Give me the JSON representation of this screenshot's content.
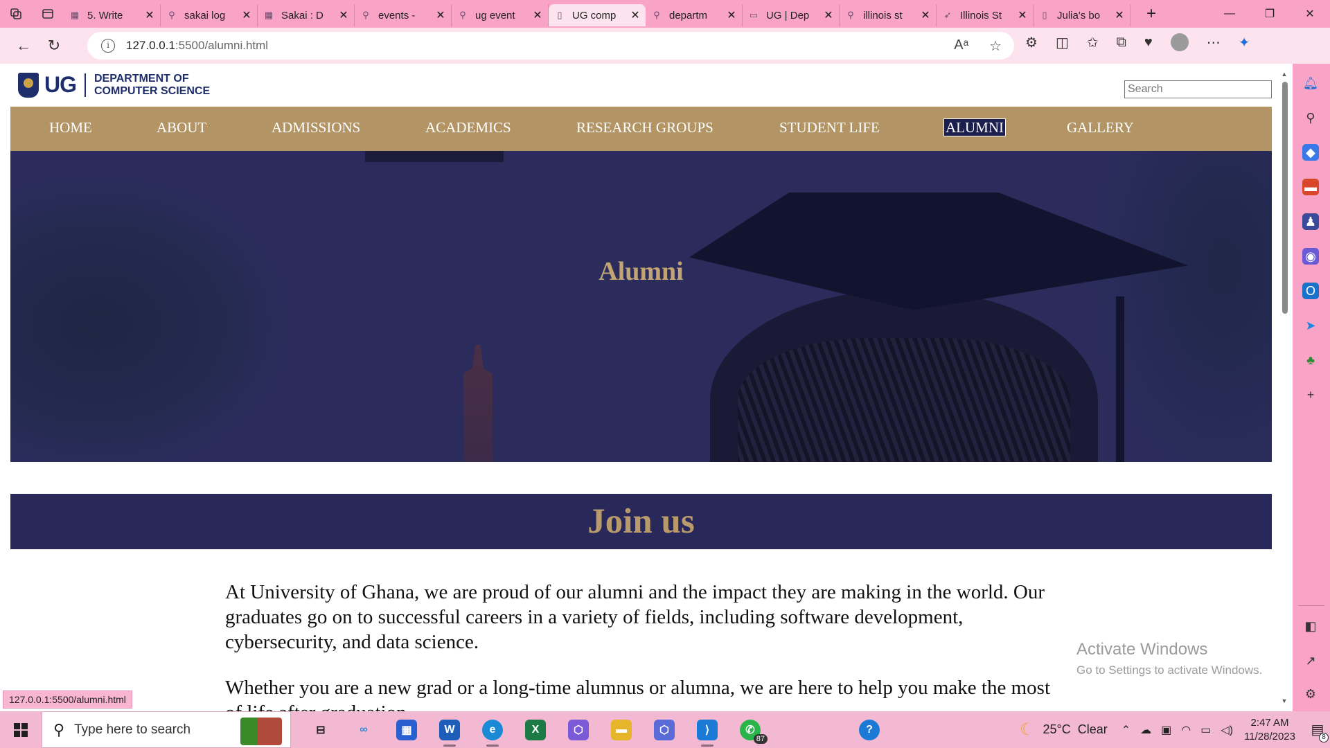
{
  "browser": {
    "tabs": [
      {
        "title": "5. Write",
        "favicon": "sakai-icon"
      },
      {
        "title": "sakai log",
        "favicon": "search-icon"
      },
      {
        "title": "Sakai : D",
        "favicon": "sakai-icon"
      },
      {
        "title": "events -",
        "favicon": "search-icon"
      },
      {
        "title": "ug event",
        "favicon": "search-icon"
      },
      {
        "title": "UG comp",
        "favicon": "document-icon",
        "active": true
      },
      {
        "title": "departm",
        "favicon": "search-icon"
      },
      {
        "title": "UG | Dep",
        "favicon": "page-icon"
      },
      {
        "title": "illinois st",
        "favicon": "search-icon"
      },
      {
        "title": "Illinois St",
        "favicon": "illinois-icon"
      },
      {
        "title": "Julia's bo",
        "favicon": "document-icon"
      }
    ],
    "url_host": "127.0.0.1",
    "url_rest": ":5500/alumni.html",
    "status_url": "127.0.0.1:5500/alumni.html"
  },
  "site": {
    "logo_text": "UG",
    "dept_line1": "DEPARTMENT OF",
    "dept_line2": "COMPUTER SCIENCE",
    "search_placeholder": "Search",
    "nav": [
      "HOME",
      "ABOUT",
      "ADMISSIONS",
      "ACADEMICS",
      "RESEARCH GROUPS",
      "STUDENT LIFE",
      "ALUMNI",
      "GALLERY"
    ],
    "active_nav": "ALUMNI",
    "hero_title": "Alumni",
    "section_title": "Join us",
    "paragraphs": [
      "At University of Ghana, we are proud of our alumni and the impact they are making in the world. Our graduates go on to successful careers in a variety of fields, including software development, cybersecurity, and data science.",
      "Whether you are a new grad or a long-time alumnus or alumna, we are here to help you make the most of life after graduation."
    ],
    "colors": {
      "gold": "#b39565",
      "navy": "#28285a",
      "title_gold": "#c3a473"
    }
  },
  "watermark": {
    "line1": "Activate Windows",
    "line2": "Go to Settings to activate Windows."
  },
  "taskbar": {
    "search_text": "Type here to search",
    "weather_temp": "25°C",
    "weather_cond": "Clear",
    "time": "2:47 AM",
    "date": "11/28/2023",
    "whatsapp_badge": "87",
    "notification_count": "8"
  }
}
